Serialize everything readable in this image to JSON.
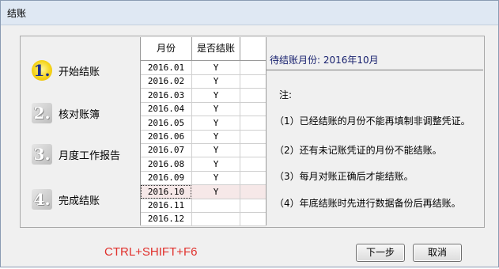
{
  "window": {
    "title": "结账"
  },
  "steps": [
    {
      "num": "1.",
      "label": "开始结账",
      "active": true
    },
    {
      "num": "2.",
      "label": "核对账簿",
      "active": false
    },
    {
      "num": "3.",
      "label": "月度工作报告",
      "active": false
    },
    {
      "num": "4.",
      "label": "完成结账",
      "active": false
    }
  ],
  "table": {
    "headers": [
      "月份",
      "是否结账"
    ],
    "rows": [
      [
        "2016.01",
        "Y"
      ],
      [
        "2016.02",
        "Y"
      ],
      [
        "2016.03",
        "Y"
      ],
      [
        "2016.04",
        "Y"
      ],
      [
        "2016.05",
        "Y"
      ],
      [
        "2016.06",
        "Y"
      ],
      [
        "2016.07",
        "Y"
      ],
      [
        "2016.08",
        "Y"
      ],
      [
        "2016.09",
        "Y"
      ],
      [
        "2016.10",
        "Y"
      ],
      [
        "2016.11",
        ""
      ],
      [
        "2016.12",
        ""
      ]
    ],
    "selected_row": "2016.10"
  },
  "info": {
    "pending_label": "待结账月份: 2016年10月",
    "note_title": "注:",
    "notes": [
      "（1）已经结账的月份不能再填制非调整凭证。",
      "（2）还有未记账凭证的月份不能结账。",
      "（3）每月对账正确后才能结账。",
      "（4）年底结账时先进行数据备份后再结账。"
    ]
  },
  "shortcut": "CTRL+SHIFT+F6",
  "buttons": {
    "next": "下一步",
    "cancel": "取消"
  },
  "colors": {
    "shortcut": "#e0302c",
    "pending_text": "#17206e",
    "selected_row": "#f6e8e8",
    "active_step": "#f5d41a"
  }
}
